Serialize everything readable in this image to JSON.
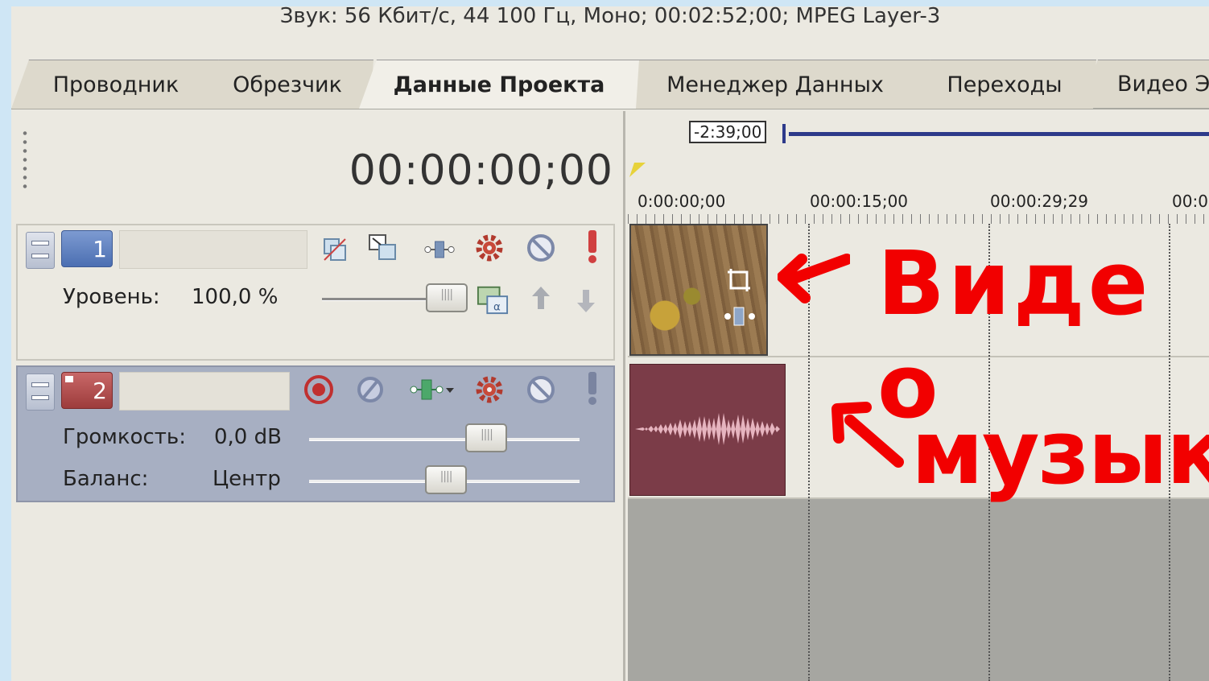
{
  "info_bar": "Звук: 56 Кбит/с, 44 100 Гц, Моно; 00:02:52;00; MPEG Layer-3",
  "tabs": [
    {
      "label": "Проводник"
    },
    {
      "label": "Обрезчик"
    },
    {
      "label": "Данные Проекта",
      "active": true
    },
    {
      "label": "Менеджер Данных"
    },
    {
      "label": "Переходы"
    },
    {
      "label": "Видео Э"
    }
  ],
  "timecode": "00:00:00;00",
  "video_track": {
    "number": "1",
    "level_label": "Уровень:",
    "level_value": "100,0 %",
    "level_fraction": 0.92
  },
  "audio_track": {
    "number": "2",
    "volume_label": "Громкость:",
    "volume_value": "0,0 dB",
    "volume_fraction": 0.65,
    "pan_label": "Баланс:",
    "pan_value": "Центр",
    "pan_fraction": 0.5
  },
  "timeline": {
    "marker": "-2:39;00",
    "ruler": [
      "0:00:00;00",
      "00:00:15;00",
      "00:00:29;29",
      "00:0"
    ]
  },
  "annotations": {
    "video": "Виде о",
    "music": "музыка"
  },
  "colors": {
    "video_track": "#5a7cc0",
    "audio_track": "#a84848",
    "audio_clip": "#7b3c48",
    "annotation": "#f20000"
  }
}
